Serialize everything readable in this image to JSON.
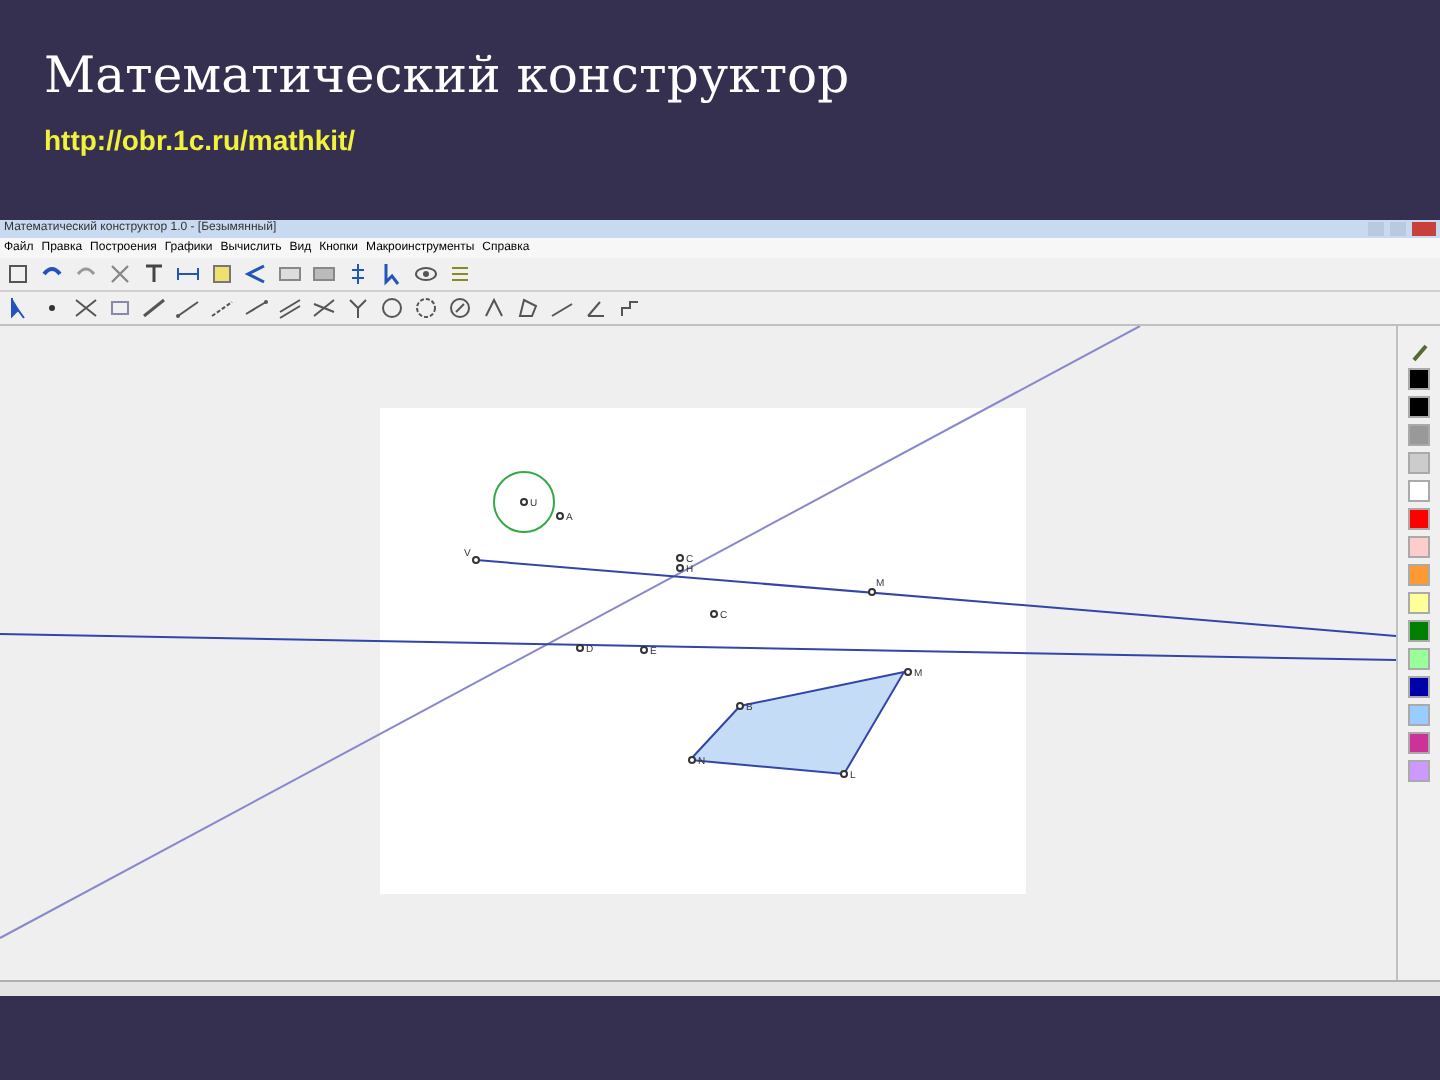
{
  "slide": {
    "title": "Математический конструктор",
    "link": "http://obr.1c.ru/mathkit/"
  },
  "window": {
    "title": "Математический конструктор 1.0 - [Безымянный]"
  },
  "menu": [
    "Файл",
    "Правка",
    "Построения",
    "Графики",
    "Вычислить",
    "Вид",
    "Кнопки",
    "Макроинструменты",
    "Справка"
  ],
  "points": [
    {
      "label": "U"
    },
    {
      "label": "A"
    },
    {
      "label": "V"
    },
    {
      "label": "C"
    },
    {
      "label": "H"
    },
    {
      "label": "M"
    },
    {
      "label": "C"
    },
    {
      "label": "D"
    },
    {
      "label": "E"
    },
    {
      "label": "M"
    },
    {
      "label": "B"
    },
    {
      "label": "N"
    },
    {
      "label": "L"
    }
  ],
  "palette": [
    {
      "color": "#000000"
    },
    {
      "color": "#000000"
    },
    {
      "color": "#999999"
    },
    {
      "color": "#cccccc"
    },
    {
      "color": "#ffffff"
    },
    {
      "color": "#ff0000"
    },
    {
      "color": "#ffcccc"
    },
    {
      "color": "#ff9933"
    },
    {
      "color": "#ffff99"
    },
    {
      "color": "#008000"
    },
    {
      "color": "#99ff99"
    },
    {
      "color": "#0000aa"
    },
    {
      "color": "#99ccff"
    },
    {
      "color": "#cc3399"
    },
    {
      "color": "#cc99ff"
    }
  ]
}
